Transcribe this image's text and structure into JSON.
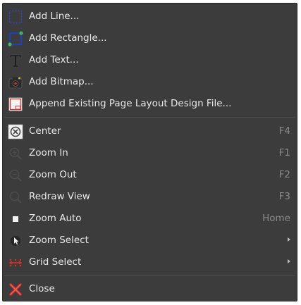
{
  "menu": {
    "add_line": {
      "label": "Add Line...",
      "icon": "add-line-icon"
    },
    "add_rectangle": {
      "label": "Add Rectangle...",
      "icon": "add-rectangle-icon"
    },
    "add_text": {
      "label": "Add Text...",
      "icon": "add-text-icon"
    },
    "add_bitmap": {
      "label": "Add Bitmap...",
      "icon": "add-bitmap-icon"
    },
    "append_layout": {
      "label": "Append Existing Page Layout Design File...",
      "icon": "append-file-icon"
    },
    "center": {
      "label": "Center",
      "shortcut": "F4",
      "icon": "center-icon"
    },
    "zoom_in": {
      "label": "Zoom In",
      "shortcut": "F1",
      "icon": "zoom-in-icon"
    },
    "zoom_out": {
      "label": "Zoom Out",
      "shortcut": "F2",
      "icon": "zoom-out-icon"
    },
    "redraw_view": {
      "label": "Redraw View",
      "shortcut": "F3",
      "icon": "redraw-icon"
    },
    "zoom_auto": {
      "label": "Zoom Auto",
      "shortcut": "Home",
      "icon": "zoom-auto-icon"
    },
    "zoom_select": {
      "label": "Zoom Select",
      "icon": "cursor-icon"
    },
    "grid_select": {
      "label": "Grid Select",
      "icon": "grid-icon"
    },
    "close": {
      "label": "Close",
      "icon": "close-icon"
    }
  },
  "colors": {
    "menu_bg": "#3c3c3c",
    "text": "#e8e8e8",
    "shortcut": "#8a8a8a",
    "close_red": "#d9332a",
    "line_blue": "#1f3fbf"
  }
}
